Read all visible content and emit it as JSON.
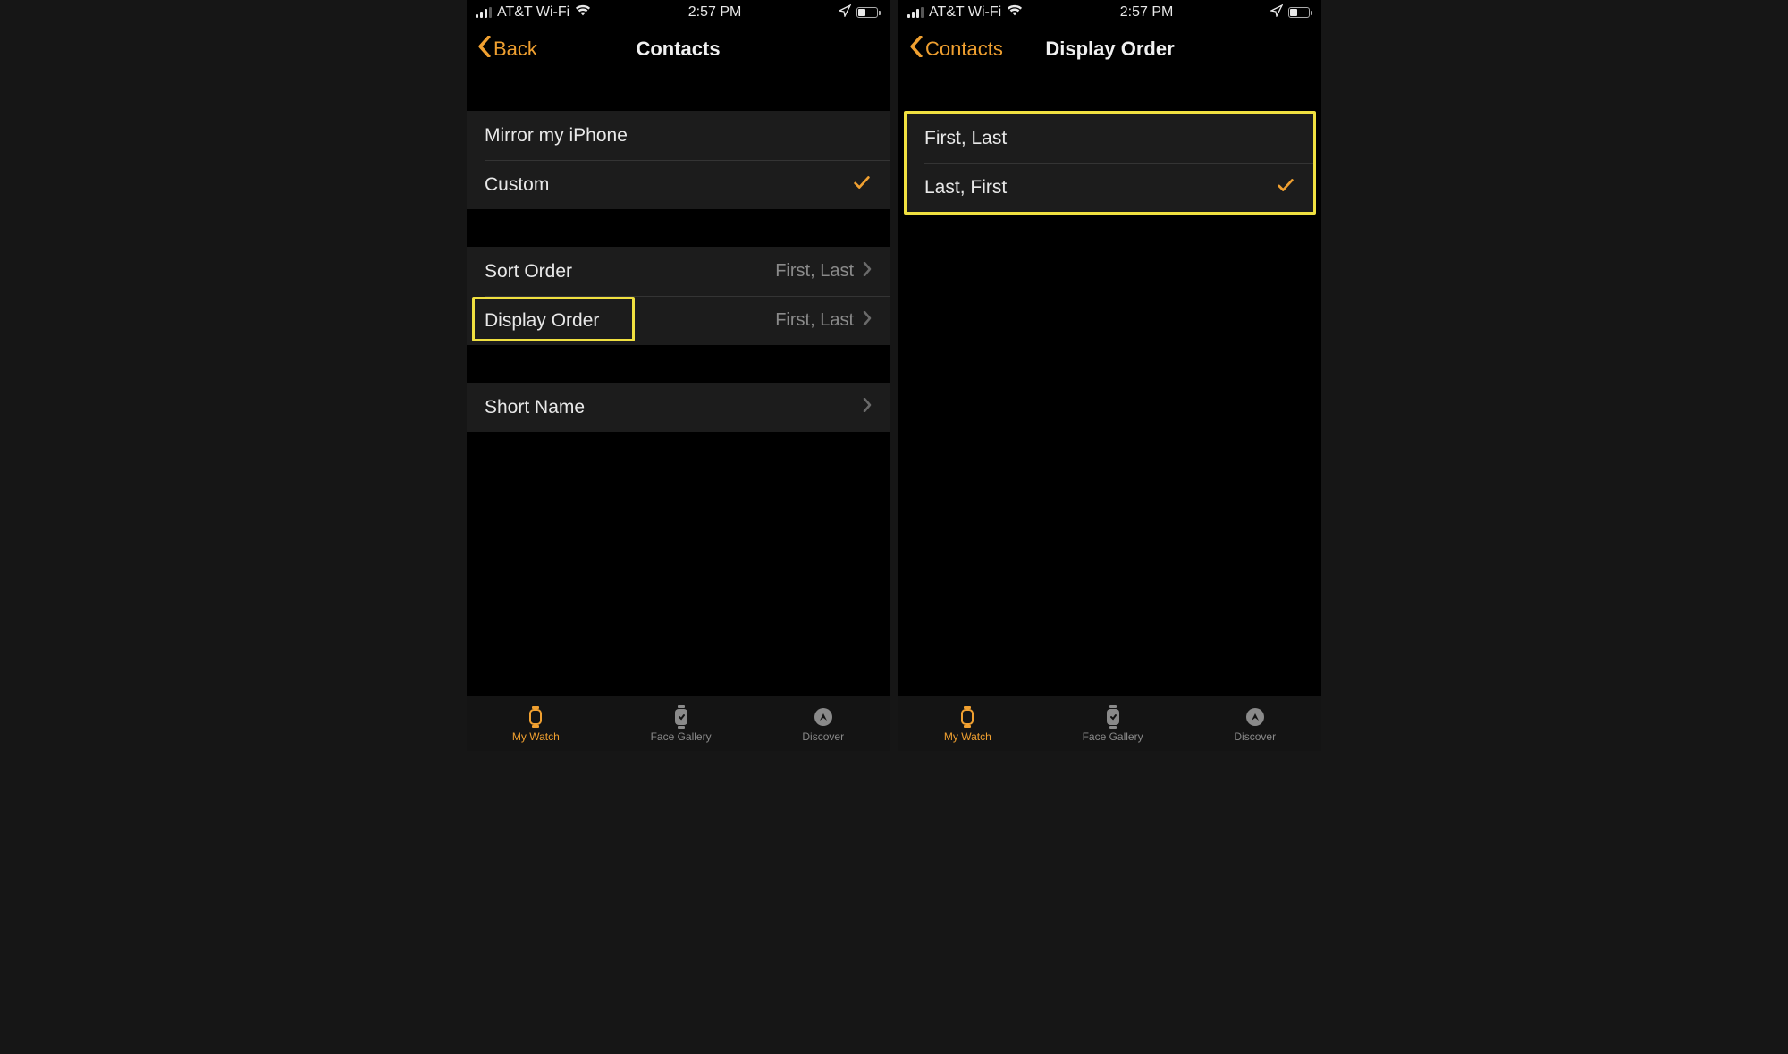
{
  "status": {
    "carrier": "AT&T Wi-Fi",
    "time": "2:57 PM"
  },
  "left_screen": {
    "back_label": "Back",
    "title": "Contacts",
    "section1": {
      "mirror": "Mirror my iPhone",
      "custom": "Custom"
    },
    "section2": {
      "sort_order_label": "Sort Order",
      "sort_order_value": "First, Last",
      "display_order_label": "Display Order",
      "display_order_value": "First, Last"
    },
    "section3": {
      "short_name": "Short Name"
    }
  },
  "right_screen": {
    "back_label": "Contacts",
    "title": "Display Order",
    "options": {
      "first_last": "First, Last",
      "last_first": "Last, First"
    }
  },
  "tabs": {
    "my_watch": "My Watch",
    "face_gallery": "Face Gallery",
    "discover": "Discover"
  },
  "colors": {
    "accent": "#f0a030",
    "highlight": "#f0e040"
  }
}
